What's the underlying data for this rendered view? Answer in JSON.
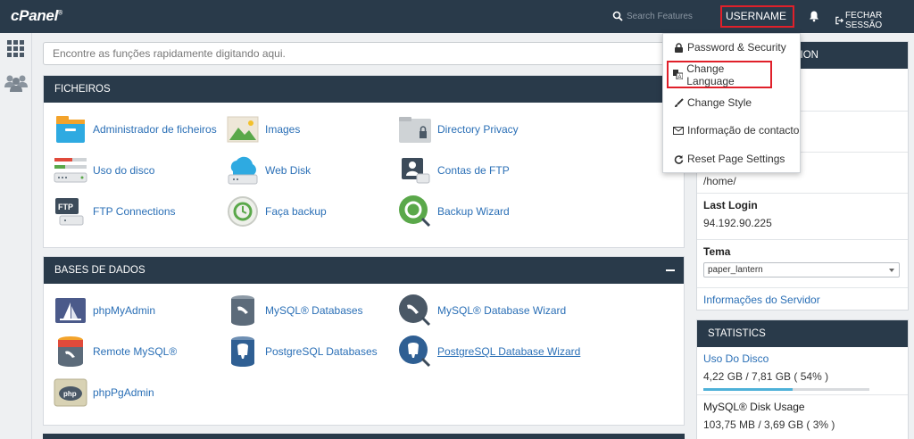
{
  "topbar": {
    "logo": "cPanel",
    "logo_mark": "®",
    "search_placeholder": "Search Features",
    "username": "USERNAME",
    "logout_label": "FECHAR SESSÃO"
  },
  "main_search": {
    "placeholder": "Encontre as funções rapidamente digitando aqui."
  },
  "sections": [
    {
      "title": "FICHEIROS",
      "items": [
        {
          "label": "Administrador de ficheiros",
          "icon": "file-manager-icon"
        },
        {
          "label": "Images",
          "icon": "images-icon"
        },
        {
          "label": "Directory Privacy",
          "icon": "directory-privacy-icon"
        },
        {
          "label": "Uso do disco",
          "icon": "disk-usage-icon"
        },
        {
          "label": "Web Disk",
          "icon": "web-disk-icon"
        },
        {
          "label": "Contas de FTP",
          "icon": "ftp-accounts-icon"
        },
        {
          "label": "FTP Connections",
          "icon": "ftp-connections-icon"
        },
        {
          "label": "Faça backup",
          "icon": "backup-icon"
        },
        {
          "label": "Backup Wizard",
          "icon": "backup-wizard-icon"
        }
      ]
    },
    {
      "title": "BASES DE DADOS",
      "items": [
        {
          "label": "phpMyAdmin",
          "icon": "phpmyadmin-icon"
        },
        {
          "label": "MySQL® Databases",
          "icon": "mysql-databases-icon"
        },
        {
          "label": "MySQL® Database Wizard",
          "icon": "mysql-wizard-icon"
        },
        {
          "label": "Remote MySQL®",
          "icon": "remote-mysql-icon"
        },
        {
          "label": "PostgreSQL Databases",
          "icon": "postgresql-databases-icon"
        },
        {
          "label": "PostgreSQL Database Wizard",
          "icon": "postgresql-wizard-icon"
        },
        {
          "label": "phpPgAdmin",
          "icon": "phppgadmin-icon",
          "badge": "php"
        }
      ]
    }
  ],
  "general_info": {
    "header_partial": "ION",
    "home_dir": "/home/",
    "last_login_label": "Last Login",
    "last_login_value": "94.192.90.225",
    "theme_label": "Tema",
    "theme_value": "paper_lantern",
    "server_info_link": "Informações do Servidor"
  },
  "statistics": {
    "title": "STATISTICS",
    "disk_usage_label": "Uso Do Disco",
    "disk_usage_value": "4,22 GB / 7,81 GB ( 54% )",
    "disk_usage_percent": 54,
    "mysql_disk_label": "MySQL® Disk Usage",
    "mysql_disk_value": "103,75 MB / 3,69 GB ( 3% )",
    "mysql_disk_percent": 3
  },
  "user_menu": {
    "items": [
      {
        "label": "Password & Security",
        "icon": "lock-icon"
      },
      {
        "label": "Change Language",
        "icon": "language-icon"
      },
      {
        "label": "Change Style",
        "icon": "brush-icon"
      },
      {
        "label": "Informação de contacto",
        "icon": "envelope-icon"
      },
      {
        "label": "Reset Page Settings",
        "icon": "refresh-icon"
      }
    ]
  },
  "colors": {
    "header_bg": "#293a4a",
    "link": "#2a6fb6",
    "highlight_border": "#e0202a",
    "bar_fill": "#4eb1d8"
  }
}
